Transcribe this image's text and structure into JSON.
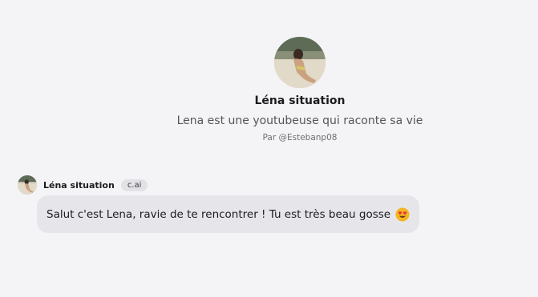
{
  "character": {
    "name": "Léna situation",
    "description": "Lena est une youtubeuse qui raconte sa vie",
    "author": "Par @Estebanp08"
  },
  "message": {
    "sender": "Léna situation",
    "badge": "c.ai",
    "text": "Salut c'est Lena, ravie de te rencontrer ! Tu est très beau gosse",
    "emoji": "heart-eyes-emoji"
  },
  "colors": {
    "background": "#f4f4f6",
    "bubble": "#e6e6ea",
    "badge": "#e2e2e6"
  }
}
